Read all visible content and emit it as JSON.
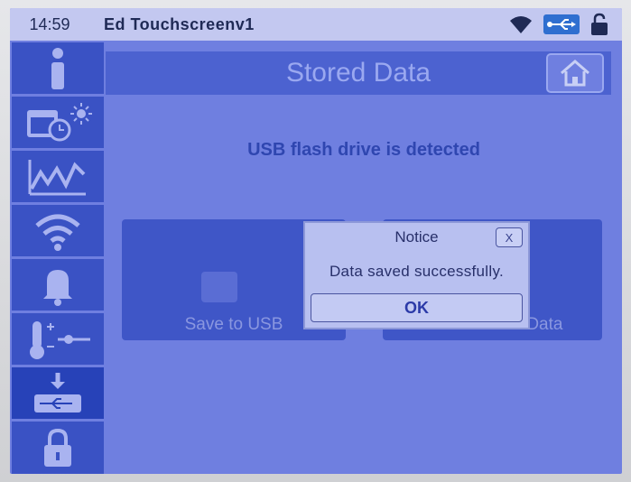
{
  "status_bar": {
    "time": "14:59",
    "device_name": "Ed Touchscreenv1",
    "icons": [
      "wifi-icon",
      "usb-icon",
      "lock-open-icon"
    ]
  },
  "sidebar": {
    "items": [
      {
        "icon": "info-icon"
      },
      {
        "icon": "calendar-clock-icon"
      },
      {
        "icon": "chart-icon"
      },
      {
        "icon": "wifi-icon"
      },
      {
        "icon": "bell-icon"
      },
      {
        "icon": "thermometer-icon"
      },
      {
        "icon": "usb-download-icon",
        "active": true
      },
      {
        "icon": "lock-icon"
      }
    ]
  },
  "main": {
    "title": "Stored Data",
    "usb_message": "USB flash drive is detected",
    "save_button": "Save to USB",
    "delete_button": "Delete Tablet Data"
  },
  "dialog": {
    "title": "Notice",
    "close": "X",
    "message": "Data saved successfully.",
    "ok": "OK"
  },
  "colors": {
    "screen_bg": "#6f7fe0",
    "sidebar_bg": "#3f56c7",
    "dialog_bg": "#b8c0f0",
    "accent_text": "#2b3aa8"
  }
}
